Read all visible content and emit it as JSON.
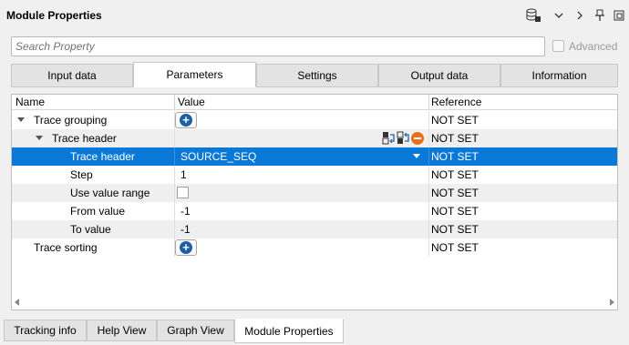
{
  "window": {
    "title": "Module Properties",
    "toolbar_icons": [
      "database-lock-icon",
      "chevron-down-icon",
      "chevron-right-icon",
      "pin-icon",
      "restore-window-icon"
    ]
  },
  "search": {
    "placeholder": "Search Property",
    "value": ""
  },
  "advanced": {
    "label": "Advanced",
    "checked": false
  },
  "tabs": [
    {
      "label": "Input data",
      "active": false
    },
    {
      "label": "Parameters",
      "active": true
    },
    {
      "label": "Settings",
      "active": false
    },
    {
      "label": "Output data",
      "active": false
    },
    {
      "label": "Information",
      "active": false
    }
  ],
  "grid": {
    "columns": [
      "Name",
      "Value",
      "Reference"
    ],
    "rows": [
      {
        "name": "Trace grouping",
        "value": "",
        "reference": "NOT SET"
      },
      {
        "name": "Trace header",
        "value": "",
        "reference": "NOT SET"
      },
      {
        "name": "Trace header",
        "value": "SOURCE_SEQ",
        "reference": "NOT SET",
        "selected": true
      },
      {
        "name": "Step",
        "value": "1",
        "reference": "NOT SET"
      },
      {
        "name": "Use value range",
        "value": "",
        "reference": "NOT SET"
      },
      {
        "name": "From value",
        "value": "-1",
        "reference": "NOT SET"
      },
      {
        "name": "To value",
        "value": "-1",
        "reference": "NOT SET"
      },
      {
        "name": "Trace sorting",
        "value": "",
        "reference": "NOT SET"
      }
    ]
  },
  "bottom_tabs": [
    {
      "label": "Tracking info",
      "active": false
    },
    {
      "label": "Help View",
      "active": false
    },
    {
      "label": "Graph View",
      "active": false
    },
    {
      "label": "Module Properties",
      "active": true
    }
  ],
  "colors": {
    "selection": "#0a78d7",
    "add_button": "#1f5fa8",
    "remove_button": "#e8701a"
  }
}
